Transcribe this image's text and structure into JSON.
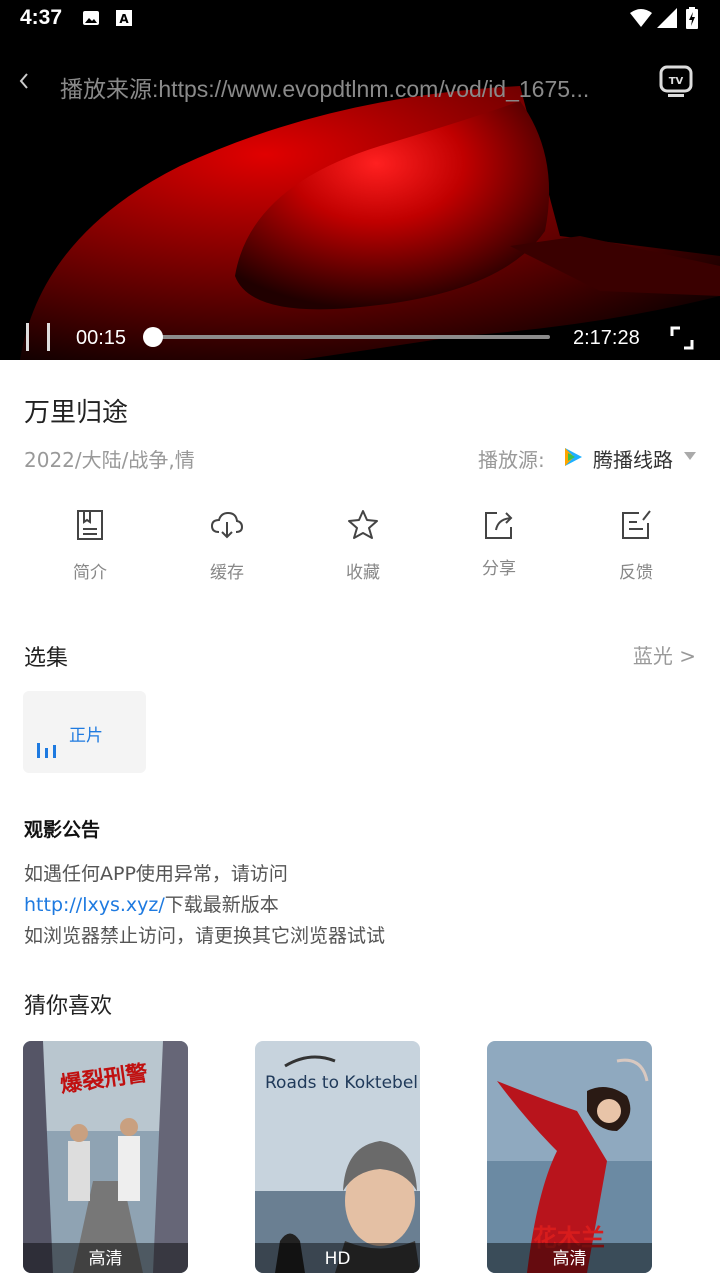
{
  "status_bar": {
    "time": "4:37",
    "icons": [
      "image-icon",
      "font-icon",
      "wifi-icon",
      "signal-icon",
      "battery-charging-icon"
    ]
  },
  "player": {
    "source_text": "播放来源:https://www.evopdtlnm.com/vod/id_1675...",
    "tv_label": "TV",
    "current_time": "00:15",
    "duration": "2:17:28",
    "progress": 0.0018
  },
  "movie": {
    "title": "万里归途",
    "meta": "2022/大陆/战争,情",
    "source_label": "播放源:",
    "source_name": "腾播线路"
  },
  "actions": [
    {
      "label": "简介",
      "icon": "book-icon"
    },
    {
      "label": "缓存",
      "icon": "cloud-download-icon"
    },
    {
      "label": "收藏",
      "icon": "star-icon"
    },
    {
      "label": "分享",
      "icon": "share-icon"
    },
    {
      "label": "反馈",
      "icon": "edit-icon"
    }
  ],
  "episodes": {
    "heading": "选集",
    "more_label": "蓝光 >",
    "items": [
      {
        "label": "正片",
        "playing": true
      }
    ]
  },
  "notice": {
    "heading": "观影公告",
    "line1": "如遇任何APP使用异常，请访问",
    "link": "http://lxys.xyz/",
    "line2_suffix": "下载最新版本",
    "line3": "如浏览器禁止访问，请更换其它浏览器试试"
  },
  "recommendations": {
    "heading": "猜你喜欢",
    "items": [
      {
        "badge": "高清",
        "poster_text": "爆裂刑警"
      },
      {
        "badge": "HD",
        "poster_text": "Roads to Koktebel"
      },
      {
        "badge": "高清",
        "poster_text": "花木兰"
      }
    ]
  },
  "colors": {
    "accent": "#1e7ae0",
    "muted": "#999999"
  }
}
